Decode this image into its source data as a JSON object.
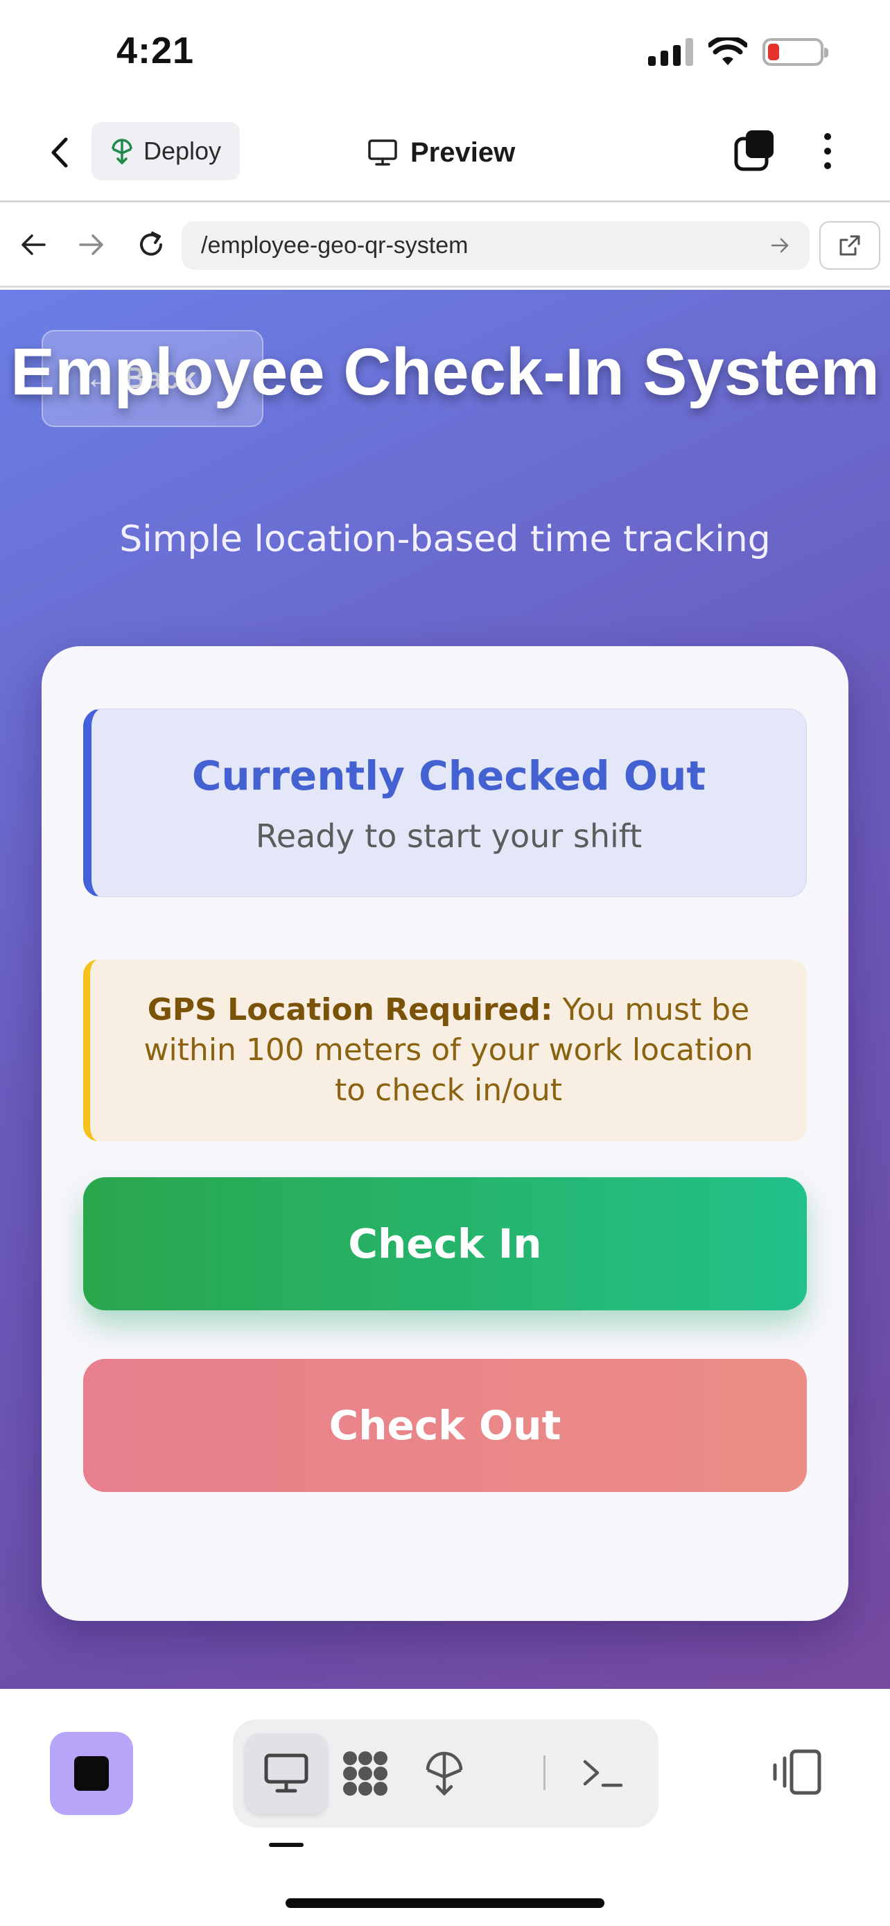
{
  "status_bar": {
    "time": "4:21"
  },
  "toolbar": {
    "deploy_label": "Deploy",
    "preview_label": "Preview"
  },
  "browser": {
    "url": "/employee-geo-qr-system"
  },
  "page": {
    "back_label": "← Back",
    "title": "Employee Check-In System",
    "subtitle": "Simple location-based time tracking"
  },
  "status_card": {
    "heading": "Currently Checked Out",
    "subtext": "Ready to start your shift"
  },
  "gps_notice": {
    "label": "GPS Location Required:",
    "text": " You must be within 100 meters of your work location to check in/out"
  },
  "buttons": {
    "check_in": "Check In",
    "check_out": "Check Out"
  },
  "colors": {
    "accent_blue": "#4461d2",
    "check_in_green": "#2aa64c",
    "check_out_red": "#e77f8c",
    "warning_yellow": "#f4c21b",
    "stop_purple": "#b7a6f7"
  },
  "icons": [
    "back-chevron-icon",
    "deploy-icon",
    "monitor-icon",
    "stack-icon",
    "more-icon",
    "arrow-left-icon",
    "arrow-right-icon",
    "reload-icon",
    "go-arrow-icon",
    "open-external-icon",
    "stop-icon",
    "desktop-icon",
    "grid-icon",
    "deploy-icon",
    "terminal-icon",
    "panel-icon"
  ]
}
